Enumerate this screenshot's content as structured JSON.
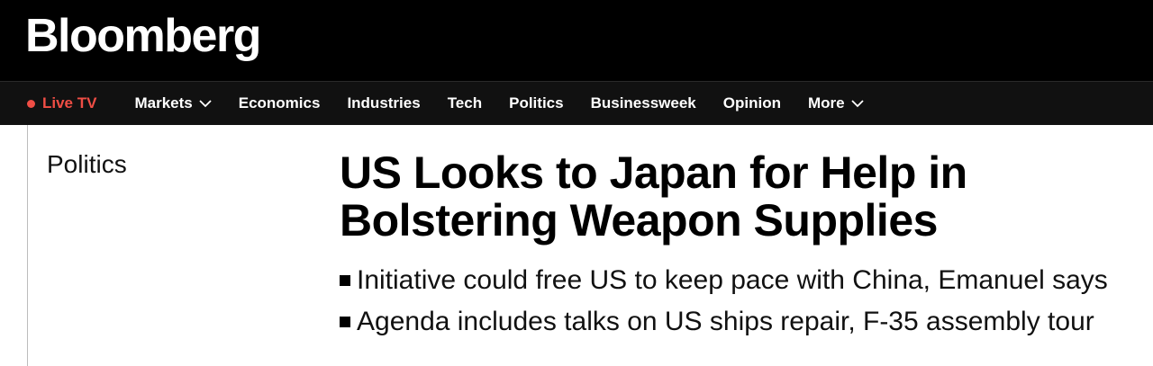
{
  "header": {
    "logo_text": "Bloomberg"
  },
  "nav": {
    "live_label": "Live TV",
    "live_color": "#f04e45",
    "items": [
      {
        "label": "Markets",
        "has_dropdown": true
      },
      {
        "label": "Economics",
        "has_dropdown": false
      },
      {
        "label": "Industries",
        "has_dropdown": false
      },
      {
        "label": "Tech",
        "has_dropdown": false
      },
      {
        "label": "Politics",
        "has_dropdown": false
      },
      {
        "label": "Businessweek",
        "has_dropdown": false
      },
      {
        "label": "Opinion",
        "has_dropdown": false
      },
      {
        "label": "More",
        "has_dropdown": true
      }
    ]
  },
  "article": {
    "section": "Politics",
    "headline": "US Looks to Japan for Help in Bolstering Weapon Supplies",
    "summary": [
      "Initiative could free US to keep pace with China, Emanuel says",
      "Agenda includes talks on US ships repair, F-35 assembly tour"
    ]
  }
}
